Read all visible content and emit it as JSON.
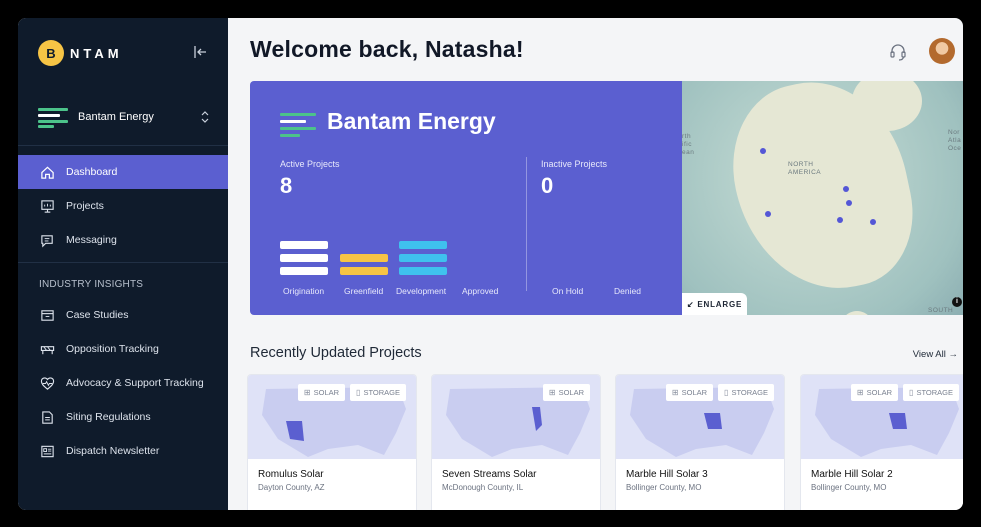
{
  "brand": {
    "logo_letter": "B",
    "name": "NTAM"
  },
  "org": {
    "name": "Bantam Energy"
  },
  "nav": {
    "items": [
      {
        "label": "Dashboard",
        "icon": "home-icon"
      },
      {
        "label": "Projects",
        "icon": "presentation-board-icon"
      },
      {
        "label": "Messaging",
        "icon": "chat-icon"
      }
    ],
    "section_heading": "INDUSTRY INSIGHTS",
    "insights": [
      {
        "label": "Case Studies",
        "icon": "folder-icon"
      },
      {
        "label": "Opposition Tracking",
        "icon": "barrier-icon"
      },
      {
        "label": "Advocacy & Support Tracking",
        "icon": "heart-pulse-icon"
      },
      {
        "label": "Siting Regulations",
        "icon": "document-icon"
      },
      {
        "label": "Dispatch Newsletter",
        "icon": "newsletter-icon"
      }
    ]
  },
  "header": {
    "welcome": "Welcome back, Natasha!"
  },
  "hero": {
    "title": "Bantam Energy",
    "active_label": "Active Projects",
    "active_value": "8",
    "inactive_label": "Inactive Projects",
    "inactive_value": "0",
    "stages": [
      "Origination",
      "Greenfield",
      "Development",
      "Approved",
      "On Hold",
      "Denied"
    ],
    "enlarge_label": "↙ ENLARGE",
    "map_labels": {
      "region": "NORTH\nAMERICA",
      "ocean": "Nor\nAtla\nOce",
      "south": "SOUTH",
      "pacific": "rth\nific\nean"
    },
    "colors": {
      "accent": "#5b5fd0",
      "greenfield": "#f6c445",
      "development": "#3fc1ee",
      "origination": "#ffffff"
    }
  },
  "recent": {
    "title": "Recently Updated Projects",
    "view_all": "View All →",
    "projects": [
      {
        "name": "Romulus Solar",
        "location": "Dayton County, AZ",
        "tags": [
          "SOLAR",
          "STORAGE"
        ]
      },
      {
        "name": "Seven Streams Solar",
        "location": "McDonough County, IL",
        "tags": [
          "SOLAR"
        ]
      },
      {
        "name": "Marble Hill Solar 3",
        "location": "Bollinger County, MO",
        "tags": [
          "SOLAR",
          "STORAGE"
        ]
      },
      {
        "name": "Marble Hill Solar 2",
        "location": "Bollinger County, MO",
        "tags": [
          "SOLAR",
          "STORAGE"
        ]
      }
    ]
  }
}
